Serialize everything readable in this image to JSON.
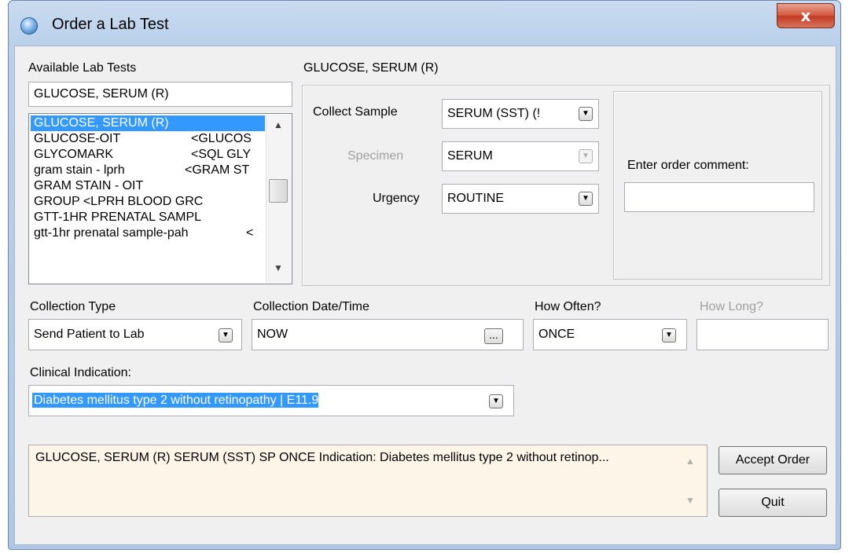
{
  "window": {
    "title": "Order a Lab Test",
    "close_glyph": "x"
  },
  "available_tests": {
    "label": "Available Lab Tests",
    "search_value": "GLUCOSE, SERUM (R)",
    "items": [
      {
        "name": "GLUCOSE, SERUM (R)",
        "alias": "",
        "selected": true
      },
      {
        "name": "GLUCOSE-OIT",
        "alias": "<GLUCOS",
        "selected": false
      },
      {
        "name": "GLYCOMARK",
        "alias": "<SQL GLY",
        "selected": false
      },
      {
        "name": "gram stain - lprh",
        "alias": "<GRAM ST",
        "selected": false
      },
      {
        "name": "GRAM STAIN - OIT",
        "alias": "",
        "selected": false
      },
      {
        "name": "GROUP  <LPRH BLOOD GRC",
        "alias": "",
        "selected": false
      },
      {
        "name": "GTT-1HR PRENATAL SAMPL",
        "alias": "",
        "selected": false
      },
      {
        "name": "gtt-1hr prenatal sample-pah",
        "alias": "<",
        "selected": false
      }
    ]
  },
  "test_details": {
    "header": "GLUCOSE, SERUM (R)",
    "collect_sample_label": "Collect Sample",
    "collect_sample_value": "SERUM (SST) (!",
    "specimen_label": "Specimen",
    "specimen_value": "SERUM",
    "urgency_label": "Urgency",
    "urgency_value": "ROUTINE",
    "comment_label": "Enter order comment:",
    "comment_value": ""
  },
  "collection": {
    "type_label": "Collection Type",
    "type_value": "Send Patient to Lab",
    "datetime_label": "Collection Date/Time",
    "datetime_value": "NOW",
    "ellipsis": "...",
    "how_often_label": "How Often?",
    "how_often_value": "ONCE",
    "how_long_label": "How Long?",
    "how_long_value": ""
  },
  "clinical_indication": {
    "label": "Clinical Indication:",
    "value": "Diabetes mellitus type 2 without retinopathy |  E11.9"
  },
  "summary": {
    "text": "GLUCOSE, SERUM (R) SERUM (SST)   SP ONCE Indication: Diabetes mellitus type 2 without retinop..."
  },
  "buttons": {
    "accept": "Accept Order",
    "quit": "Quit"
  },
  "icons": {
    "dropdown": "▼",
    "scroll_up": "▲",
    "scroll_down": "▼"
  },
  "colors": {
    "selection": "#3399ff",
    "summary_bg": "#fdf6e8"
  }
}
